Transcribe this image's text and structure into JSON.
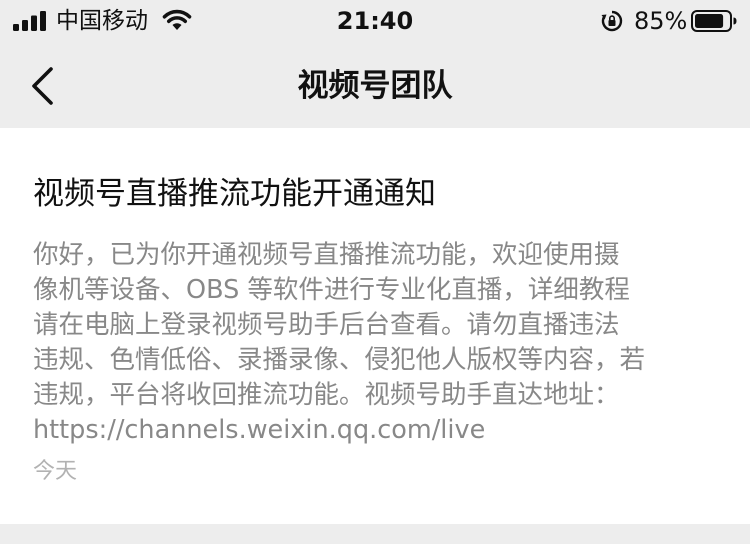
{
  "status_bar": {
    "carrier": "中国移动",
    "time": "21:40",
    "battery_percent": "85%",
    "battery_level": 0.85,
    "signal_bars": 4
  },
  "nav": {
    "title": "视频号团队",
    "back_icon": "chevron-left-icon"
  },
  "notice": {
    "title": "视频号直播推流功能开通通知",
    "body_lines": [
      "你好，已为你开通视频号直播推流功能，欢迎使用摄",
      "像机等设备、OBS 等软件进行专业化直播，详细教程",
      "请在电脑上登录视频号助手后台查看。请勿直播违法",
      "违规、色情低俗、录播录像、侵犯他人版权等内容，若",
      "违规，平台将收回推流功能。视频号助手直达地址：",
      "https://channels.weixin.qq.com/live"
    ],
    "date": "今天"
  },
  "colors": {
    "background": "#ededed",
    "card": "#ffffff",
    "body_text": "#888888",
    "date_text": "#b2b2b2"
  }
}
